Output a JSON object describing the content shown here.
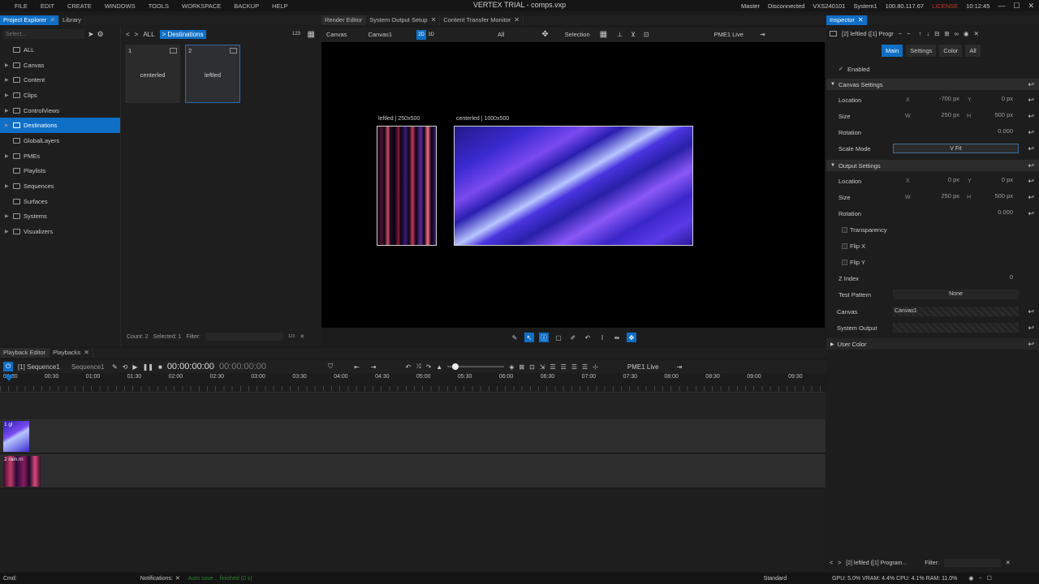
{
  "menu": [
    "FILE",
    "EDIT",
    "CREATE",
    "WINDOWS",
    "TOOLS",
    "WORKSPACE",
    "BACKUP",
    "HELP"
  ],
  "window_title": "VERTEX TRIAL - comps.vxp",
  "status": {
    "role": "Master",
    "conn": "Disconnected",
    "id": "VXS240101",
    "system": "System1",
    "ip": "100.80.117.67",
    "license": "LICENSE",
    "time": "10:12:45"
  },
  "left_tabs": [
    "Project Explorer",
    "Library"
  ],
  "search_placeholder": "Select...",
  "tree": [
    {
      "label": "ALL",
      "arrow": ""
    },
    {
      "label": "Canvas",
      "arrow": "▶"
    },
    {
      "label": "Content",
      "arrow": "▶"
    },
    {
      "label": "Clips",
      "arrow": "▶"
    },
    {
      "label": "ControlViews",
      "arrow": "▶"
    },
    {
      "label": "Destinations",
      "arrow": "▶"
    },
    {
      "label": "GlobalLayers",
      "arrow": ""
    },
    {
      "label": "PMEs",
      "arrow": "▶"
    },
    {
      "label": "Playlists",
      "arrow": ""
    },
    {
      "label": "Sequences",
      "arrow": "▶"
    },
    {
      "label": "Surfaces",
      "arrow": ""
    },
    {
      "label": "Systems",
      "arrow": "▶"
    },
    {
      "label": "Visualizers",
      "arrow": "▶"
    }
  ],
  "library": {
    "breadcrumb_all": "ALL",
    "breadcrumb_current": "> Destinations",
    "cards": [
      {
        "num": "1",
        "label": "centerled"
      },
      {
        "num": "2",
        "label": "leftled"
      }
    ],
    "count": "Count: 2",
    "selected": "Selected: 1",
    "filter": "Filter:"
  },
  "center_tabs": [
    "Render Editor",
    "System Output Setup",
    "Content Transfer Monitor"
  ],
  "render_toolbar": {
    "canvas": "Canvas",
    "canvas1": "Canvas1",
    "mode2d": "2D",
    "mode3d": "3D",
    "all": "All",
    "selection": "Selection",
    "pme": "PME1 Live"
  },
  "viewport": {
    "left_label": "leftled | 250x500",
    "right_label": "centerled | 1000x500"
  },
  "inspector": {
    "tab": "Inspector",
    "header_title": "[2] leftled ([1] Progr",
    "subtabs": [
      "Main",
      "Settings",
      "Color",
      "All"
    ],
    "enabled": "Enabled",
    "canvas_settings": "Canvas Settings",
    "output_settings": "Output Settings",
    "location": "Location",
    "size": "Size",
    "rotation": "Rotation",
    "scale_mode": "Scale Mode",
    "scale_mode_value": "V Fit",
    "cs_x": "-700",
    "cs_y": "0",
    "cs_w": "250",
    "cs_h": "500",
    "cs_rot": "0.000",
    "os_x": "0",
    "os_y": "0",
    "os_w": "250",
    "os_h": "500",
    "os_rot": "0.000",
    "px": "px",
    "transparency": "Transparency",
    "flipx": "Flip X",
    "flipy": "Flip Y",
    "zindex": "Z Index",
    "zindex_val": "0",
    "test_pattern": "Test Pattern",
    "test_pattern_val": "None",
    "canvas": "Canvas",
    "canvas_val": "Canvas1",
    "system_output": "System Output",
    "user_color": "User Color",
    "footer_item": "[2] leftled ([1] Program...",
    "footer_filter": "Filter:"
  },
  "bottom_tabs": [
    "Playback Editor",
    "Playbacks"
  ],
  "playback": {
    "seq": "[1] Sequence1",
    "seq2": "Sequence1",
    "time": "00:00:00:00",
    "time2": "00:00:00:00",
    "pme": "PME1 Live",
    "ticks": [
      "00:00",
      "00:30",
      "01:00",
      "01:30",
      "02:00",
      "02:30",
      "03:00",
      "03:30",
      "04:00",
      "04:30",
      "05:00",
      "05:30",
      "06:00",
      "06:30",
      "07:00",
      "07:30",
      "08:00",
      "08:30",
      "09:00",
      "09:30"
    ],
    "clip1": "1 gl",
    "clip2": "2 rain.m"
  },
  "statusbar": {
    "cmd": "Cmd:",
    "notifications": "Notifications:",
    "autosave": "Auto save... finished (0 s)",
    "workspace": "Standard",
    "perf": "GPU: 5.0% VRAM: 4.4% CPU: 4.1% RAM: 11.0%"
  }
}
